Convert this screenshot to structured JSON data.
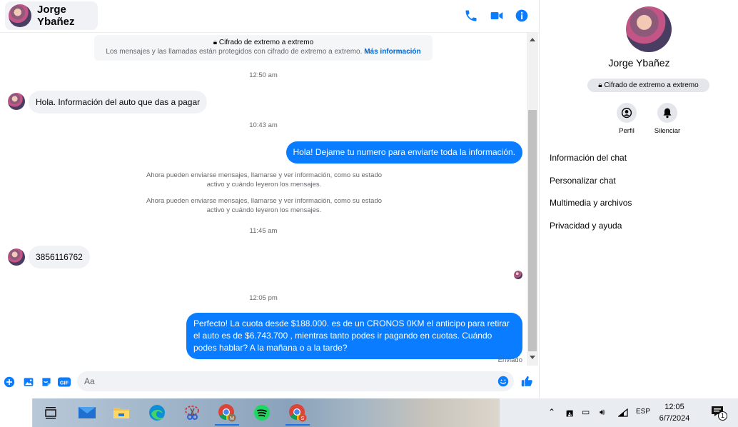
{
  "contact": {
    "name": "Jorge Ybañez"
  },
  "header_icons": [
    "phone-icon",
    "video-icon",
    "info-icon"
  ],
  "encryption_banner": {
    "title": "Cifrado de extremo a extremo",
    "text": "Los mensajes y las llamadas están protegidos con cifrado de extremo a extremo.",
    "link": "Más información"
  },
  "messages": {
    "ts1": "12:50 am",
    "m1": "Hola. Información del auto que das a pagar",
    "ts2": "10:43 am",
    "m2": "Hola! Dejame tu numero  para enviarte toda la información.",
    "sys1": "Ahora pueden enviarse mensajes, llamarse y ver información, como su estado activo y cuándo leyeron los mensajes.",
    "sys2": "Ahora pueden enviarse mensajes, llamarse y ver información, como su estado activo y cuándo leyeron los mensajes.",
    "ts3": "11:45 am",
    "m3": "3856116762",
    "ts4": "12:05 pm",
    "m4": "Perfecto! La cuota desde $188.000. es de un CRONOS 0KM el anticipo para retirar el auto es de $6.743.700 , mientras tanto podes ir pagando en cuotas. Cuándo podes hablar? A la mañana o a la tarde?",
    "status": "Enviado"
  },
  "composer": {
    "placeholder": "Aa"
  },
  "info_panel": {
    "name": "Jorge Ybañez",
    "badge": "Cifrado de extremo a extremo",
    "actions": {
      "profile": "Perfil",
      "mute": "Silenciar"
    },
    "menu": [
      "Información del chat",
      "Personalizar chat",
      "Multimedia y archivos",
      "Privacidad y ayuda"
    ]
  },
  "taskbar": {
    "lang": "ESP",
    "time": "12:05",
    "date": "6/7/2024",
    "notifications": "1",
    "chrome_badge_1": "M",
    "chrome_badge_2": "S"
  },
  "colors": {
    "accent": "#0a7cff",
    "link": "#0064d1"
  }
}
